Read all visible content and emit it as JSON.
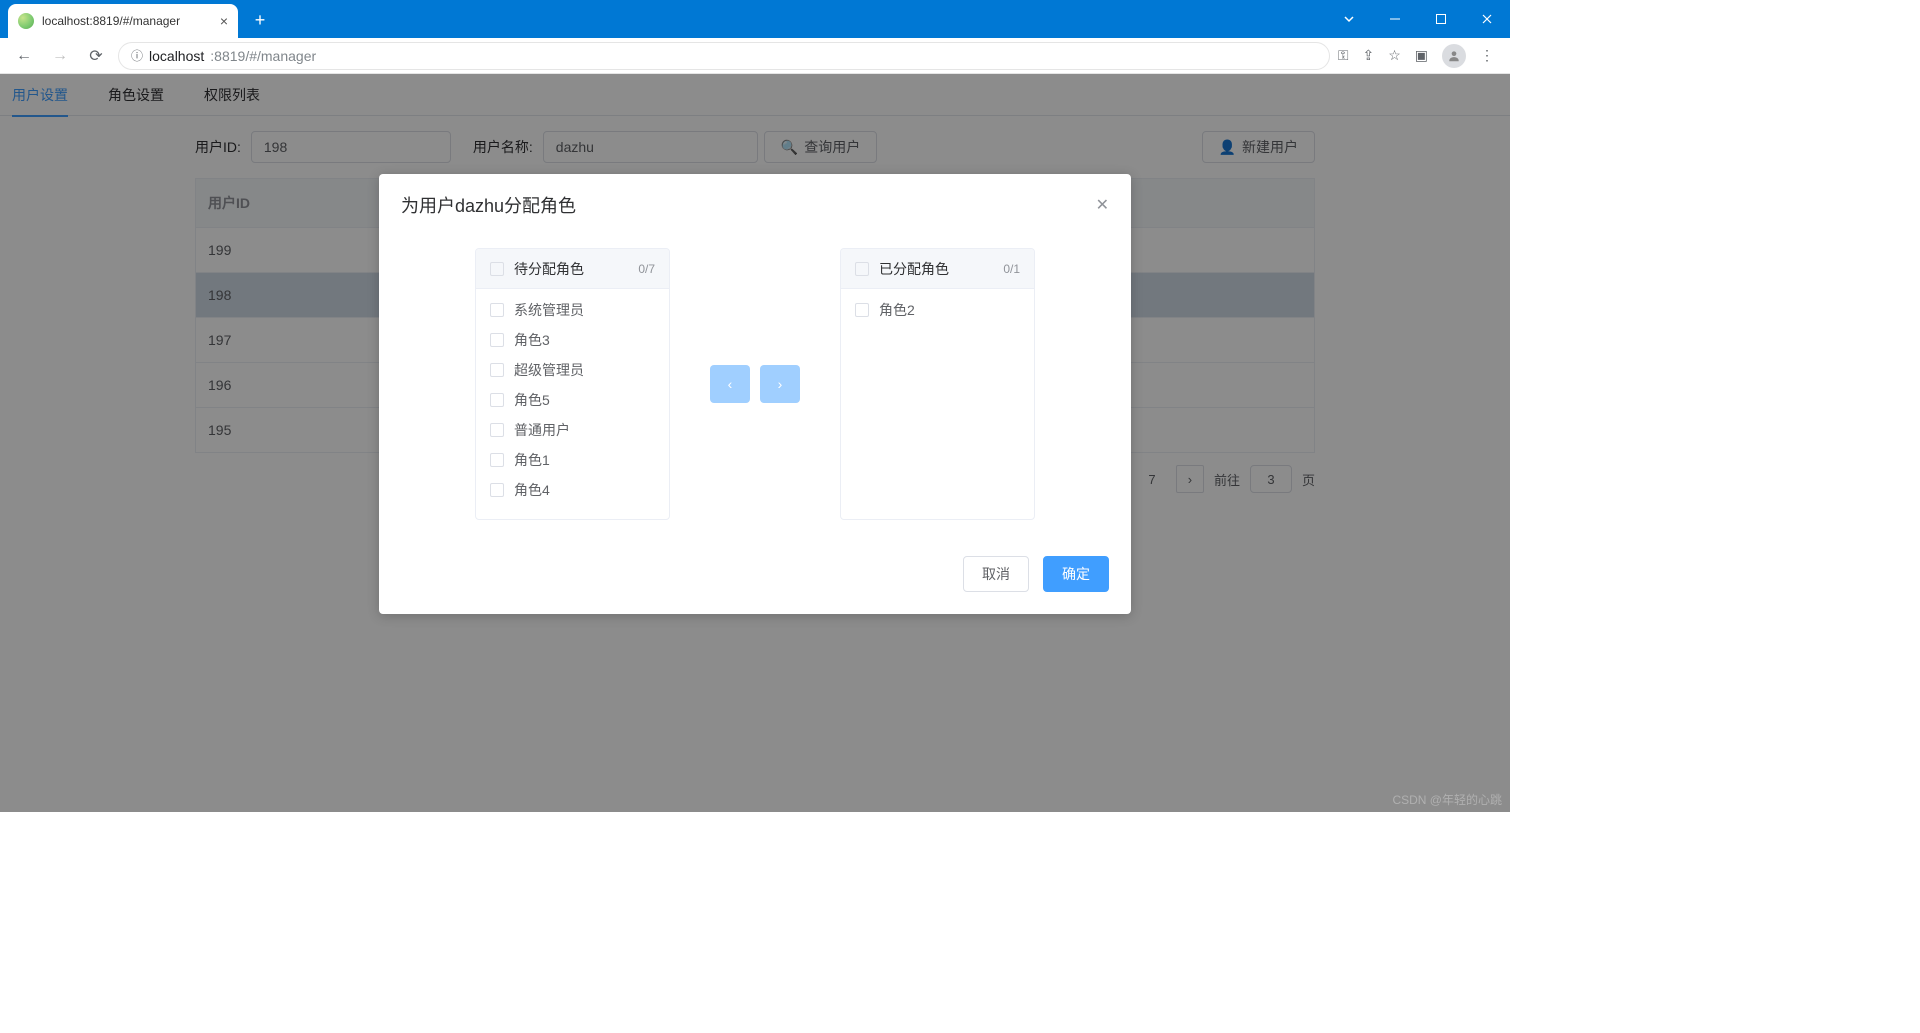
{
  "browser": {
    "tab_title": "localhost:8819/#/manager",
    "url_host": "localhost",
    "url_port_path": ":8819/#/manager"
  },
  "nav_tabs": [
    "用户设置",
    "角色设置",
    "权限列表"
  ],
  "filters": {
    "user_id_label": "用户ID:",
    "user_id_value": "198",
    "user_name_label": "用户名称:",
    "user_name_value": "dazhu",
    "search_btn": "查询用户",
    "new_btn": "新建用户"
  },
  "table": {
    "header": "用户ID",
    "rows": [
      "199",
      "198",
      "197",
      "196",
      "195"
    ],
    "selected_index": 1
  },
  "pagination": {
    "visible_page": "7",
    "jump_label": "前往",
    "jump_value": "3",
    "page_suffix": "页"
  },
  "dialog": {
    "title": "为用户dazhu分配角色",
    "left_panel_title": "待分配角色",
    "left_panel_count": "0/7",
    "left_items": [
      "系统管理员",
      "角色3",
      "超级管理员",
      "角色5",
      "普通用户",
      "角色1",
      "角色4"
    ],
    "right_panel_title": "已分配角色",
    "right_panel_count": "0/1",
    "right_items": [
      "角色2"
    ],
    "cancel": "取消",
    "confirm": "确定"
  },
  "watermark": "CSDN @年轻的心跳"
}
